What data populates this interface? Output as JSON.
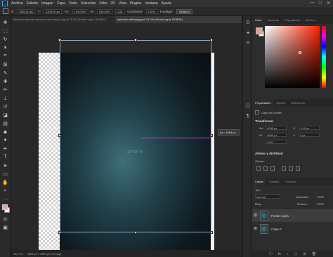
{
  "menu": {
    "logo": "Ps",
    "items": [
      "Archivo",
      "Edición",
      "Imagen",
      "Capa",
      "Texto",
      "Selección",
      "Filtro",
      "3D",
      "Vista",
      "Plugins",
      "Ventana",
      "Ayuda"
    ],
    "window_controls": [
      "—",
      "□",
      "✕"
    ]
  },
  "options": {
    "x_label": "X:",
    "x_value": "2823,00 px",
    "y_label": "Y:",
    "y_value": "2333,00 px",
    "w_label": "An:",
    "w_value": "100,00%",
    "h_label": "Al:",
    "h_value": "100,00%",
    "angle_value": "0,00",
    "interp_label": "Contrastar:",
    "interp_value": "100%",
    "deform_label": "Fundigar:",
    "deform_value": "Ninguna"
  },
  "tabs": [
    {
      "label": "ejercicio-rellenar-canvas-b-web-studio.jpg al 18,3% (Fondo capa, RGB/8*)",
      "active": false
    },
    {
      "label": "ejercicio-rellenar.jpg al 13,2% (Fondo capa, RGB/8*)",
      "active": true
    }
  ],
  "canvas": {
    "photo_label": "photo",
    "measure_label": "An.: 4085 px"
  },
  "status": {
    "zoom": "13,17%",
    "doc_size": "4905 px x 4905 px (72 ppp)"
  },
  "color_panel": {
    "tabs": [
      "Color",
      "Muestras",
      "Degradados",
      "Motivos"
    ],
    "fg_color": "#e8a093",
    "bg_color": "#ffffff"
  },
  "properties": {
    "tabs": [
      "Propiedades",
      "Ajustes",
      "Bibliotecas"
    ],
    "layer_kind": "Capa de píxeles",
    "transform_title": "Transformar",
    "w_label": "An:",
    "w_value": "4085 px",
    "h_label": "Al:",
    "h_value": "4905 px",
    "x_label": "X:",
    "x_value": "-410 px",
    "y_label": "Y:",
    "y_value": "0 px",
    "angle_value": "0,00°",
    "align_title": "Alinear y distribuir",
    "align_label": "Alinear:"
  },
  "layers": {
    "tabs": [
      "Capas",
      "Canales",
      "Trazados"
    ],
    "filter_label": "Tipo",
    "blend_mode": "Normal",
    "opacity_label": "Opacidad:",
    "opacity_value": "100%",
    "lock_label": "Bloq.:",
    "fill_label": "Relleno:",
    "fill_value": "100%",
    "items": [
      {
        "name": "Fondo copia",
        "selected": true
      },
      {
        "name": "Capa 0",
        "selected": false
      }
    ],
    "footer_icons": [
      "ⓕ",
      "fx",
      "◐",
      "▢",
      "⊞",
      "🗑"
    ]
  }
}
